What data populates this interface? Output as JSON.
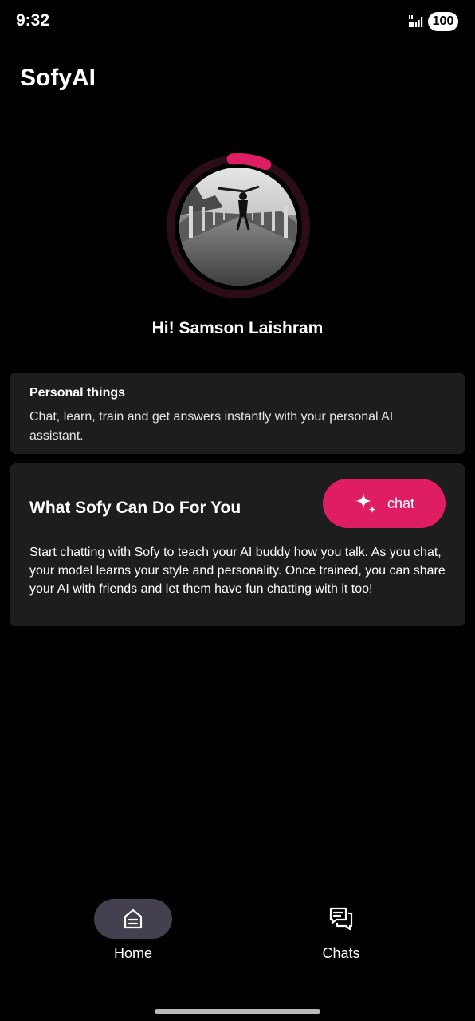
{
  "status_bar": {
    "time": "9:32",
    "battery": "100",
    "signal_icon": "signal-bars-icon"
  },
  "app": {
    "title": "SofyAI"
  },
  "profile": {
    "greeting": "Hi! Samson Laishram",
    "ring_progress": 0.08,
    "ring_color": "#df1d63"
  },
  "personal_card": {
    "heading": "Personal things",
    "body": "Chat, learn, train and get answers instantly with your personal AI assistant."
  },
  "sofy_card": {
    "heading": "What Sofy Can Do For You",
    "chat_button_label": "chat",
    "chat_button_icon": "sparkle-icon",
    "body": "Start chatting with Sofy to teach your AI buddy how you talk. As you chat, your model learns your style and personality. Once trained, you can share your AI with friends and let them have fun chatting with it too!"
  },
  "bottom_nav": {
    "items": [
      {
        "label": "Home",
        "icon": "home-icon",
        "active": true
      },
      {
        "label": "Chats",
        "icon": "chats-icon",
        "active": false
      }
    ]
  },
  "colors": {
    "accent": "#df1d63",
    "card_background": "#1d1d1d",
    "nav_active_background": "#44404f"
  }
}
